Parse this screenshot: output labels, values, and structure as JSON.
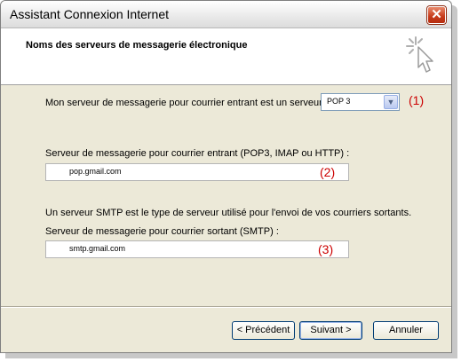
{
  "window": {
    "title": "Assistant Connexion Internet",
    "close_symbol": "✕"
  },
  "header": {
    "title": "Noms des serveurs de messagerie électronique",
    "icon": "wizard-cursor-icon"
  },
  "incoming_type": {
    "label": "Mon serveur de messagerie pour courrier entrant est un serveur",
    "selected": "POP 3",
    "annotation": "(1)"
  },
  "incoming_server": {
    "label": "Serveur de messagerie pour courrier entrant (POP3, IMAP ou HTTP) :",
    "value": "pop.gmail.com",
    "annotation": "(2)"
  },
  "smtp_info": "Un serveur SMTP est le type de serveur utilisé pour l'envoi de vos courriers sortants.",
  "outgoing_server": {
    "label": "Serveur de messagerie pour courrier sortant (SMTP) :",
    "value": "smtp.gmail.com",
    "annotation": "(3)"
  },
  "buttons": {
    "back": "< Précédent",
    "next": "Suivant >",
    "cancel": "Annuler"
  },
  "colors": {
    "annotation": "#cc0000",
    "close": "#c63a1a"
  }
}
